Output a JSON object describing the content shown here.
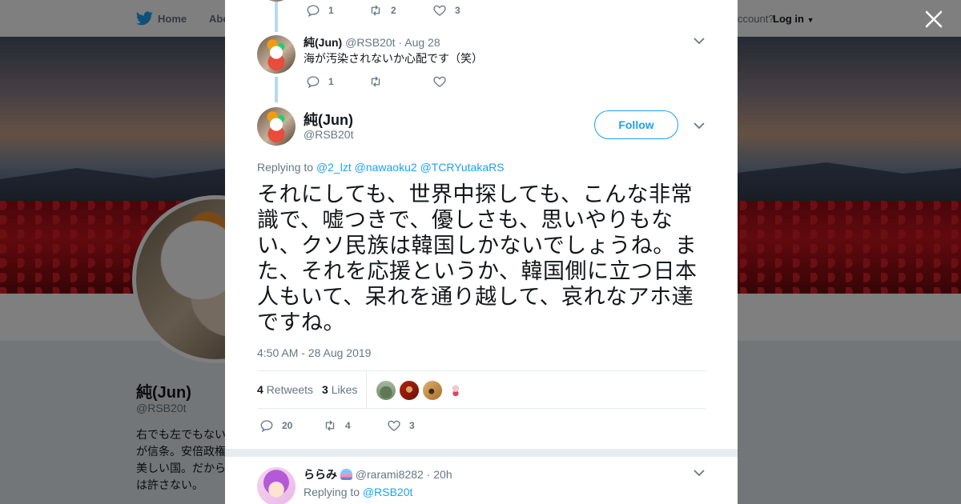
{
  "topbar": {
    "home_label": "Home",
    "about_label": "Abo",
    "account_question": "ccount?",
    "login_label": "Log in"
  },
  "profile": {
    "name": "純(Jun)",
    "handle": "@RSB20t",
    "bio": "右でも左でもない が信条。安倍政権 美しい国。だから は許さない。"
  },
  "thread": [
    {
      "reply_count": "1",
      "retweet_count": "2",
      "like_count": "3"
    },
    {
      "name": "純(Jun)",
      "handle": "@RSB20t",
      "date": "· Aug 28",
      "text": "海が汚染されないか心配です（笑）",
      "reply_count": "1",
      "retweet_count": "",
      "like_count": ""
    }
  ],
  "main_tweet": {
    "name": "純(Jun)",
    "handle": "@RSB20t",
    "follow_label": "Follow",
    "replying_to_label": "Replying to",
    "replying_to": [
      "@2_lzt",
      "@nawaoku2",
      "@TCRYutakaRS"
    ],
    "text": "それにしても、世界中探しても、こんな非常識で、嘘つきで、優しさも、思いやりもない、クソ民族は韓国しかないでしょうね。また、それを応援というか、韓国側に立つ日本人もいて、呆れを通り越して、哀れなアホ達ですね。",
    "timestamp": "4:50 AM - 28 Aug 2019",
    "retweets_count": "4",
    "retweets_label": "Retweets",
    "likes_count": "3",
    "likes_label": "Likes",
    "reply_count": "20",
    "retweet_count": "4",
    "like_count": "3"
  },
  "reply": {
    "name": "ららみ",
    "handle": "@rarami8282",
    "date": "· 20h",
    "replying_to_label": "Replying to",
    "replying_to": "@RSB20t"
  },
  "colors": {
    "accent": "#1da1f2",
    "thread_line": "#b5d9f2",
    "muted": "#657786"
  }
}
